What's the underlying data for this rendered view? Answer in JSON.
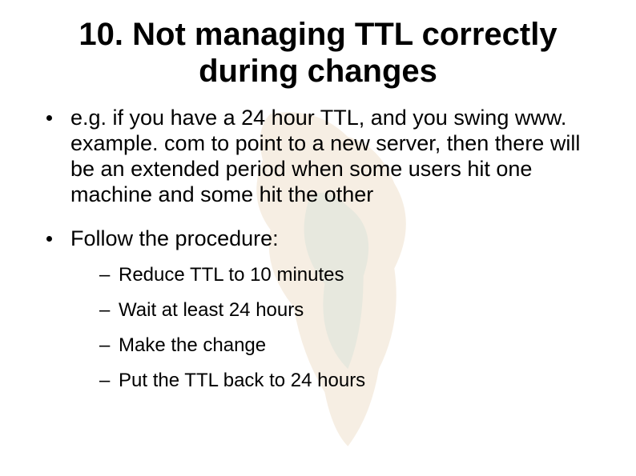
{
  "title": "10. Not managing TTL correctly during changes",
  "bullets": [
    {
      "text": "e.g. if you have a 24 hour TTL, and you swing www. example. com to point to a new server, then there will be an extended period when some users hit one machine and some hit the other"
    },
    {
      "text": "Follow the procedure:",
      "sub": [
        "Reduce TTL to 10 minutes",
        "Wait at least 24 hours",
        "Make the change",
        "Put the TTL back to 24 hours"
      ]
    }
  ]
}
